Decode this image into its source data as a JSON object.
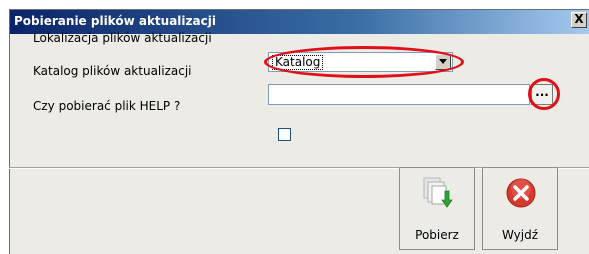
{
  "window": {
    "title": "Pobieranie plików aktualizacji",
    "close_label": "X"
  },
  "form": {
    "location_label": "Lokalizacja plików aktualizacji",
    "location_value": "Katalog",
    "folder_label": "Katalog plików aktualizacji",
    "folder_value": "",
    "browse_label": "...",
    "help_label": "Czy pobierać plik HELP ?",
    "help_checked": false
  },
  "toolbar": {
    "download_label": "Pobierz",
    "exit_label": "Wyjdź"
  },
  "colors": {
    "highlight": "#e0101a",
    "exit_icon": "#d63a2f",
    "download_arrow": "#2fa336"
  },
  "icons": {
    "download": "download-files-icon",
    "exit": "exit-x-icon",
    "dropdown": "chevron-down-icon"
  }
}
